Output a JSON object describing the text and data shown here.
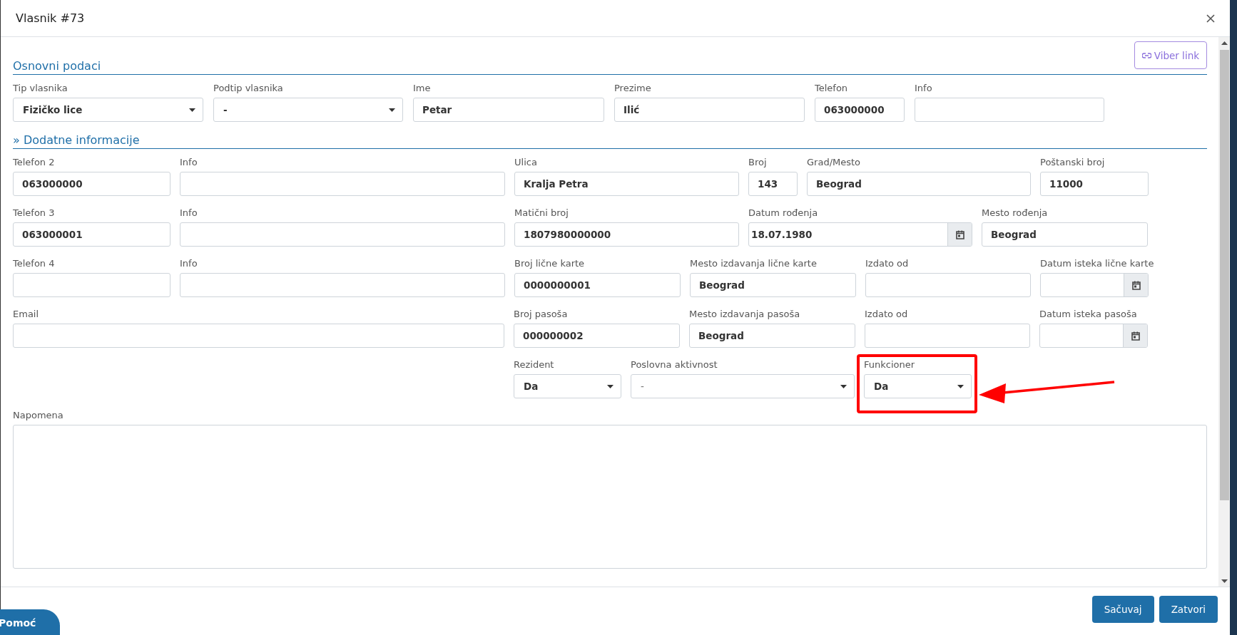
{
  "dialog": {
    "title": "Vlasnik #73",
    "viber_button": "Viber link",
    "sections": [
      {
        "heading": "Osnovni podaci",
        "fields": [
          {
            "label": "Tip vlasnika",
            "kind": "select",
            "value": "Fizičko lice",
            "highlighted": false
          },
          {
            "label": "Podtip vlasnika",
            "kind": "select",
            "value": "-",
            "highlighted": false
          },
          {
            "label": "Ime",
            "kind": "text",
            "value": "Petar",
            "highlighted": false
          },
          {
            "label": "Prezime",
            "kind": "text",
            "value": "Ilić",
            "highlighted": false
          },
          {
            "label": "Telefon",
            "kind": "text",
            "value": "063000000",
            "highlighted": false
          },
          {
            "label": "Info",
            "kind": "text",
            "highlighted": false
          }
        ]
      },
      {
        "heading": "» Dodatne informacije",
        "fields": [
          {
            "label": "Telefon 2",
            "kind": "text",
            "value": "063000000",
            "highlighted": false
          },
          {
            "label": "Info",
            "kind": "text",
            "highlighted": false
          },
          {
            "label": "Ulica",
            "kind": "text",
            "value": "Kralja Petra",
            "highlighted": false
          },
          {
            "label": "Broj",
            "kind": "text",
            "value": "143",
            "highlighted": false
          },
          {
            "label": "Grad/Mesto",
            "kind": "text",
            "value": "Beograd",
            "highlighted": false
          },
          {
            "label": "Poštanski broj",
            "kind": "text",
            "value": "11000",
            "highlighted": false
          },
          {
            "label": "Telefon 3",
            "kind": "text",
            "value": "063000001",
            "highlighted": false
          },
          {
            "label": "Info",
            "kind": "text",
            "highlighted": false
          },
          {
            "label": "Matični broj",
            "kind": "text",
            "value": "1807980000000",
            "highlighted": false
          },
          {
            "label": "Datum rođenja",
            "kind": "date",
            "value": "18.07.1980",
            "highlighted": false
          },
          {
            "label": "Mesto rođenja",
            "kind": "text",
            "value": "Beograd",
            "highlighted": false
          },
          {
            "label": "Telefon 4",
            "kind": "text",
            "highlighted": false
          },
          {
            "label": "Info",
            "kind": "text",
            "highlighted": false
          },
          {
            "label": "Broj lične karte",
            "kind": "text",
            "value": "0000000001",
            "highlighted": false
          },
          {
            "label": "Mesto izdavanja lične karte",
            "kind": "text",
            "value": "Beograd",
            "highlighted": false
          },
          {
            "label": "Izdato od",
            "kind": "text",
            "highlighted": false
          },
          {
            "label": "Datum isteka lične karte",
            "kind": "date",
            "highlighted": false
          },
          {
            "label": "Email",
            "kind": "text",
            "highlighted": false
          },
          {
            "label": "Broj pasoša",
            "kind": "text",
            "value": "000000002",
            "highlighted": false
          },
          {
            "label": "Mesto izdavanja pasoša",
            "kind": "text",
            "value": "Beograd",
            "highlighted": false
          },
          {
            "label": "Izdato od",
            "kind": "text",
            "highlighted": false
          },
          {
            "label": "Datum isteka pasoša",
            "kind": "date",
            "highlighted": false
          },
          {
            "label": "Rezident",
            "kind": "select",
            "value": "Da",
            "highlighted": false
          },
          {
            "label": "Poslovna aktivnost",
            "kind": "select",
            "placeholder": "-",
            "highlighted": false
          },
          {
            "label": "Funkcioner",
            "kind": "select",
            "value": "Da",
            "highlighted": true
          }
        ]
      }
    ],
    "note": {
      "label": "Napomena"
    },
    "buttons": [
      "Sačuvaj",
      "Zatvori"
    ]
  },
  "help_button": "Pomoć"
}
